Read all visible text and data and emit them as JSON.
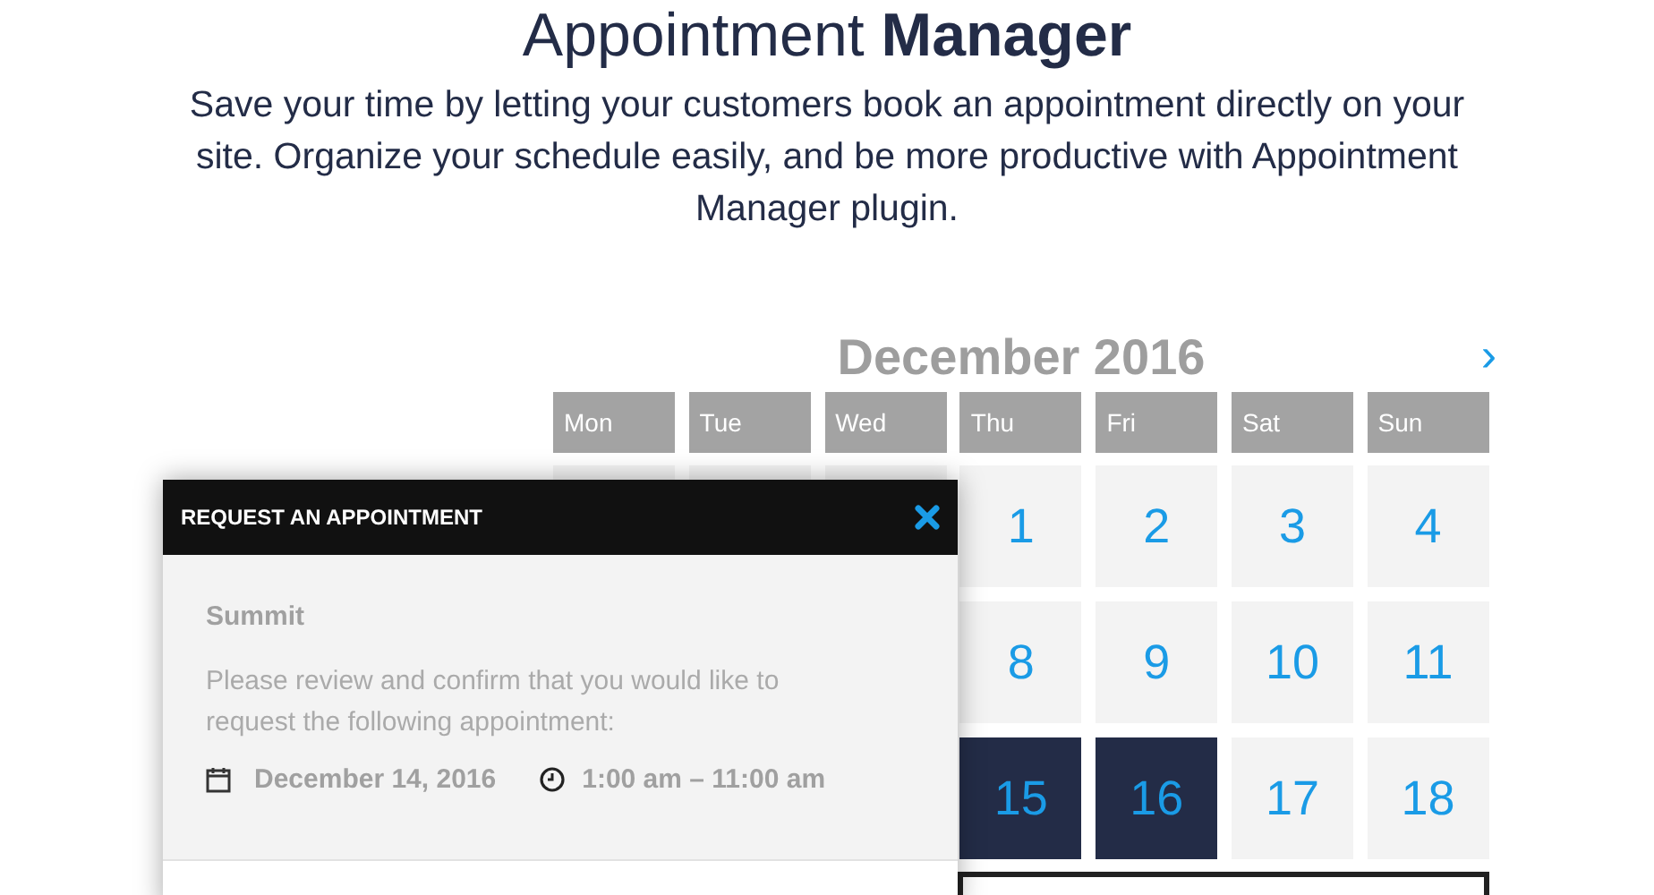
{
  "heading": "Appointment **Manager**",
  "intro": "Save your time by letting your customers book an appointment directly on your site. Organize your schedule easily, and be more productive with Appointment Manager plugin.",
  "calendar": {
    "month": "December 2016",
    "next": "›",
    "weekdays": [
      "Mon",
      "Tue",
      "Wed",
      "Thu",
      "Fri",
      "Sat",
      "Sun"
    ],
    "weeks": [
      [
        {
          "day": "1",
          "selected": false
        },
        {
          "day": "2",
          "selected": false
        },
        {
          "day": "3",
          "selected": false
        },
        {
          "day": "4",
          "selected": false
        }
      ],
      [
        {
          "day": "8",
          "selected": false
        },
        {
          "day": "9",
          "selected": false
        },
        {
          "day": "10",
          "selected": false
        },
        {
          "day": "11",
          "selected": false
        }
      ],
      [
        {
          "day": "15",
          "selected": true
        },
        {
          "day": "16",
          "selected": true
        },
        {
          "day": "17",
          "selected": false
        },
        {
          "day": "18",
          "selected": false
        }
      ]
    ]
  },
  "popup": {
    "title": "REQUEST AN APPOINTMENT",
    "service": "Summit",
    "message": "Please review and confirm that you would like to request the following appointment:",
    "date": "December 14, 2016",
    "time": "1:00 am – 11:00 am"
  }
}
